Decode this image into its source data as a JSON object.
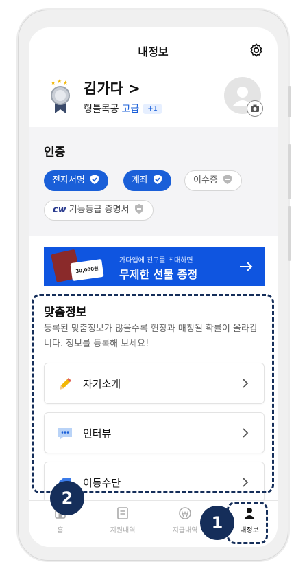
{
  "header": {
    "title": "내정보"
  },
  "profile": {
    "name": "김가다 >",
    "job": "형틀목공",
    "grade": "고급",
    "extra": "+1"
  },
  "certification": {
    "title": "인증",
    "chips": [
      {
        "label": "전자서명",
        "verified": true
      },
      {
        "label": "계좌",
        "verified": true
      },
      {
        "label": "이수증",
        "verified": false
      },
      {
        "logo": "cw",
        "label": "기능등급 증명서",
        "verified": false
      }
    ]
  },
  "banner": {
    "subtitle": "가다앱에 친구를 초대하면",
    "title": "무제한 선물 증정",
    "ticket": "30,000원"
  },
  "custom_info": {
    "title": "맞춤정보",
    "description": "등록된 맞춤정보가 많을수록 현장과 매칭될 확률이 올라갑니다. 정보를 등록해 보세요!",
    "items": [
      {
        "icon": "pencil-icon",
        "label": "자기소개"
      },
      {
        "icon": "chat-bubble-icon",
        "label": "인터뷰"
      },
      {
        "icon": "vehicle-icon",
        "label": "이동수단"
      }
    ]
  },
  "tabs": [
    {
      "label": "홈",
      "icon": "home-icon"
    },
    {
      "label": "지원내역",
      "icon": "document-icon"
    },
    {
      "label": "지급내역",
      "icon": "won-icon"
    },
    {
      "label": "내정보",
      "icon": "person-icon",
      "active": true
    }
  ],
  "annotations": [
    {
      "number": "1"
    },
    {
      "number": "2"
    }
  ],
  "colors": {
    "accent": "#1a5fd8",
    "annotation": "#152e5a",
    "banner": "#0f55e0"
  }
}
